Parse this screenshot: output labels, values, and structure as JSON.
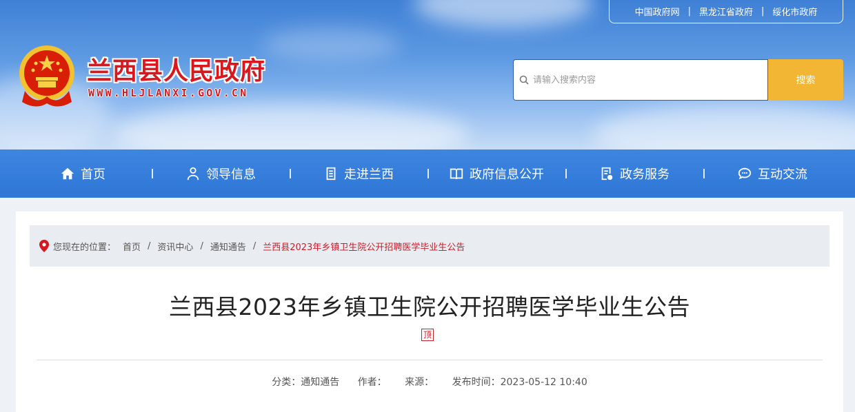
{
  "header": {
    "top_links": [
      "中国政府网",
      "黑龙江省政府",
      "绥化市政府"
    ],
    "site_title": "兰西县人民政府",
    "site_url": "WWW.HLJLANXI.GOV.CN",
    "search": {
      "placeholder": "请输入搜索内容",
      "button_label": "搜索"
    }
  },
  "nav": {
    "items": [
      {
        "label": "首页",
        "icon": "home-icon"
      },
      {
        "label": "领导信息",
        "icon": "user-icon"
      },
      {
        "label": "走进兰西",
        "icon": "document-list-icon"
      },
      {
        "label": "政府信息公开",
        "icon": "book-icon"
      },
      {
        "label": "政务服务",
        "icon": "clipboard-check-icon"
      },
      {
        "label": "互动交流",
        "icon": "chat-bubble-icon"
      }
    ]
  },
  "breadcrumb": {
    "prefix": "您现在的位置：",
    "items": [
      "首页",
      "资讯中心",
      "通知通告"
    ],
    "current": "兰西县2023年乡镇卫生院公开招聘医学毕业生公告"
  },
  "article": {
    "title": "兰西县2023年乡镇卫生院公开招聘医学毕业生公告",
    "print_label": "顶",
    "meta": {
      "category": "分类：通知通告",
      "author": "作者：",
      "source": "来源：",
      "published": "发布时间：2023-05-12 10:40"
    }
  },
  "colors": {
    "nav_blue": "#2f76d5",
    "accent_red": "#c8202a",
    "search_button": "#f3b634"
  }
}
